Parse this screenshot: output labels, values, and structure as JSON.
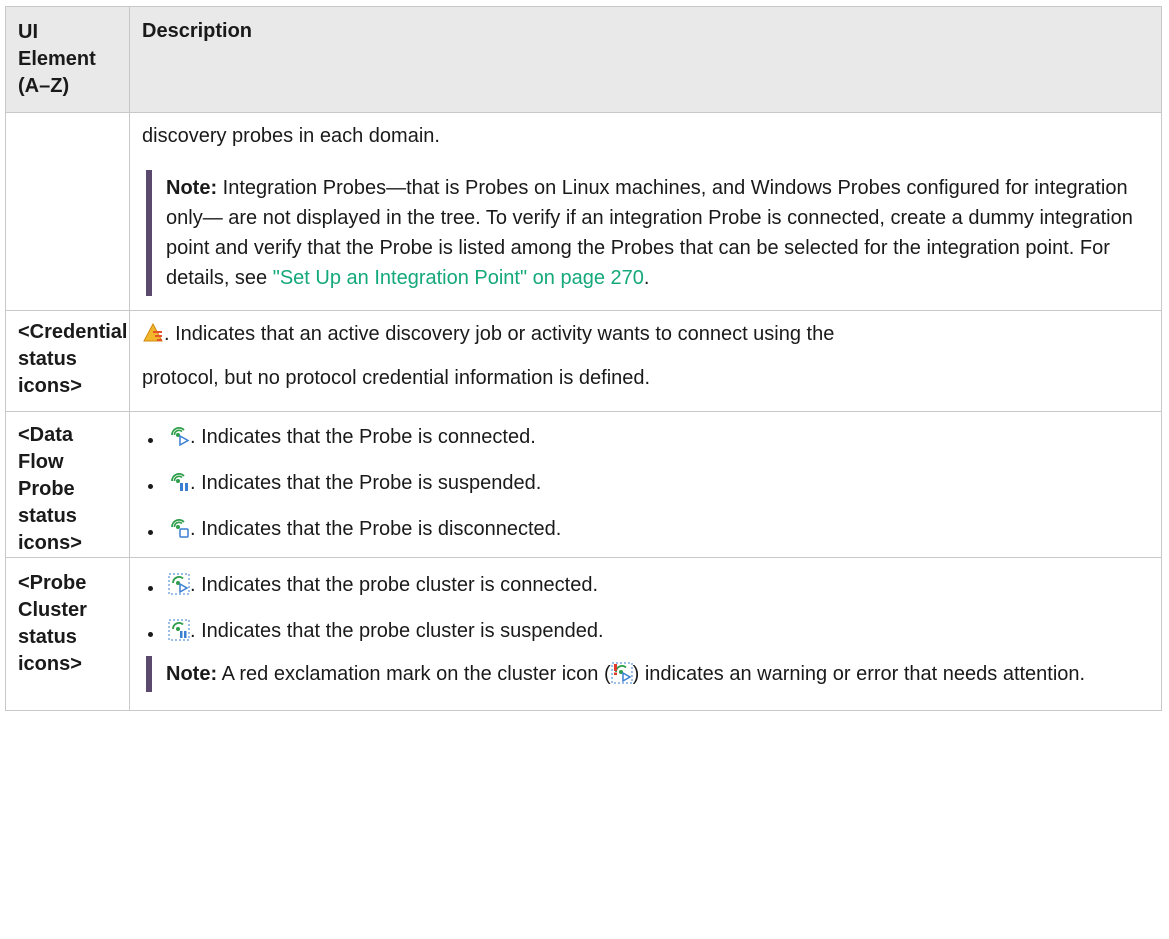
{
  "header": {
    "col_element": "UI Element (A–Z)",
    "col_description": "Description"
  },
  "rows": [
    {
      "element": "",
      "lead": "discovery probes in each domain.",
      "note_label": "Note:",
      "note_text": " Integration Probes—that is Probes on Linux machines, and Windows Probes configured for integration only— are not displayed in the tree. To verify if an integration Probe is connected, create a dummy integration point and verify that the Probe is listed among the Probes that can be selected for the integration point. For details, see ",
      "note_link": "\"Set Up an Integration Point\" on page 270",
      "note_end": "."
    },
    {
      "element": "<Credential status icons>",
      "text1": ". Indicates that an active discovery job or activity wants to connect using the",
      "text2": "protocol, but no protocol credential information is defined.",
      "icon": "credential-warning-icon"
    },
    {
      "element": "<Data Flow Probe status icons>",
      "items": [
        {
          "icon": "probe-connected-icon",
          "text": ". Indicates that the Probe is connected."
        },
        {
          "icon": "probe-suspended-icon",
          "text": ". Indicates that the Probe is suspended."
        },
        {
          "icon": "probe-disconnected-icon",
          "text": ". Indicates that the Probe is disconnected."
        }
      ]
    },
    {
      "element": "<Probe Cluster status icons>",
      "items": [
        {
          "icon": "cluster-connected-icon",
          "text": ". Indicates that the probe cluster is connected."
        },
        {
          "icon": "cluster-suspended-icon",
          "text": ". Indicates that the probe cluster is suspended."
        }
      ],
      "note_label": "Note:",
      "note_before": " A red exclamation mark on the cluster icon (",
      "note_after": ") indicates an warning or error that needs attention.",
      "note_icon": "cluster-error-icon"
    }
  ],
  "colors": {
    "header_bg": "#e9e9e9",
    "note_bar": "#5c4a6e",
    "link": "#14a87a",
    "probe_green": "#2e9e4a",
    "probe_blue": "#3a7fd1"
  }
}
